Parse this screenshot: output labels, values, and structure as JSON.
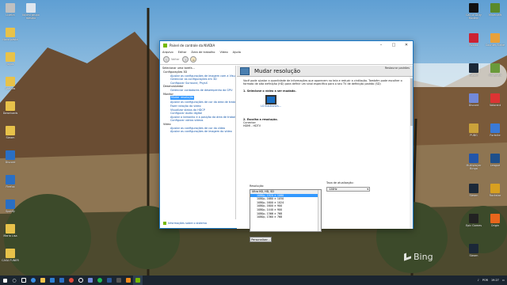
{
  "window": {
    "title": "Painel de controle da NVIDIA"
  },
  "menu": [
    "Arquivo",
    "Editar",
    "Área de trabalho",
    "Vídeo",
    "Ajuda"
  ],
  "toolbar": {
    "back": "Voltar"
  },
  "left_panel": {
    "header": "Selecionar uma tarefa...",
    "tree": [
      {
        "type": "cat",
        "label": "Configurações 3D"
      },
      {
        "type": "sub",
        "label": "Ajustar as configurações de imagem com a Visualização"
      },
      {
        "type": "sub",
        "label": "Gerenciar as configurações em 3D"
      },
      {
        "type": "sub",
        "label": "Configurar Surround, PhysX"
      },
      {
        "type": "cat",
        "label": "Desenvolvedor"
      },
      {
        "type": "sub",
        "label": "Gerenciar contadores de desempenho da GPU"
      },
      {
        "type": "cat",
        "label": "Monitor"
      },
      {
        "type": "sub",
        "label": "Mudar resolução",
        "selected": true
      },
      {
        "type": "sub",
        "label": "Ajustar as configurações de cor da área de trabalho"
      },
      {
        "type": "sub",
        "label": "Fazer rotação do vídeo"
      },
      {
        "type": "sub",
        "label": "Visualizar status do HDCP"
      },
      {
        "type": "sub",
        "label": "Configurar áudio digital"
      },
      {
        "type": "sub",
        "label": "Ajustar o tamanho e a posição da área de trabalho"
      },
      {
        "type": "sub",
        "label": "Configurar vários vídeos"
      },
      {
        "type": "cat",
        "label": "Vídeo"
      },
      {
        "type": "sub",
        "label": "Ajustar as configurações de cor do vídeo"
      },
      {
        "type": "sub",
        "label": "Ajustar as configurações de imagem do vídeo"
      }
    ],
    "system_info": "Informações sobre o sistema"
  },
  "page": {
    "title": "Mudar resolução",
    "restore": "Restaurar padrões",
    "description": "Você pode ajustar a quantidade de informações que aparecem na tela e reduzir a cintilação. Também pode escolher o formato de alta definição (HD) para definir um sinal específico para o seu TV de definição padrão (SD)",
    "step1": "1. Selecione o vídeo a ser mudado.",
    "monitor_label": "LG Electronics...",
    "step2": "2. Escolha a resolução.",
    "connector_label": "Conector:",
    "connector_value": "HDMI - HDTV",
    "resolution_label": "Resolução:",
    "refresh_label": "Taxa de atualização:",
    "refresh_value": "120Hz",
    "resolutions": [
      {
        "label": "Ultra HD, HD, SD",
        "group": true
      },
      {
        "label": "1080p, 1920 × 1080",
        "selected": true
      },
      {
        "label": "1080p, 1680 × 1050"
      },
      {
        "label": "1080p, 1600 × 1024"
      },
      {
        "label": "1080p, 1600 × 900"
      },
      {
        "label": "1080p, 1440 × 900"
      },
      {
        "label": "1080p, 1366 × 768"
      },
      {
        "label": "1080p, 1360 × 768"
      }
    ],
    "customize_button": "Personalizar..."
  },
  "desktop_icons_left": [
    "Lixeira",
    "Nova pasta",
    "Jogos",
    "Atalhos",
    "Downloads",
    "Steam",
    "Discord",
    "Firefox",
    "Spotify",
    "Maria Lisa",
    "CASA FUNER"
  ],
  "desktop_icons_top": [
    "Lixeira",
    "ibidmi grupo mesmo"
  ],
  "desktop_icons_right": [
    "Call of Duty Modern",
    "Minecraft",
    "Roblox",
    "Counter-Strike",
    "Steam",
    "Minecraft",
    "Discord",
    "Valorant",
    "PUBG",
    "Fortnite",
    "Multiplayer Bingo",
    "League",
    "Steam",
    "Rockstar",
    "Epic Games",
    "Origin",
    "Steam"
  ],
  "taskbar": {
    "lang": "POR",
    "time": "19:27"
  },
  "wallpaper_brand": "Bing"
}
